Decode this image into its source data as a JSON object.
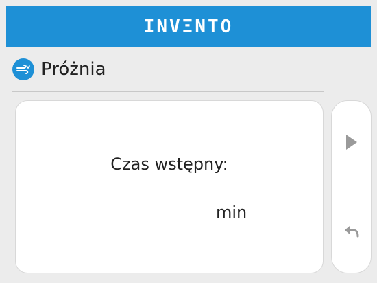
{
  "header": {
    "brand_before": "INV",
    "brand_mid": "Ξ",
    "brand_after": "NTO",
    "brand_color": "#1e90d6"
  },
  "section": {
    "icon": "fan-wind-icon",
    "title": "Próżnia"
  },
  "card": {
    "label": "Czas wstępny:",
    "value": "",
    "unit": "min"
  },
  "side_buttons": {
    "play_icon": "play-icon",
    "back_icon": "back-arrow-icon"
  }
}
